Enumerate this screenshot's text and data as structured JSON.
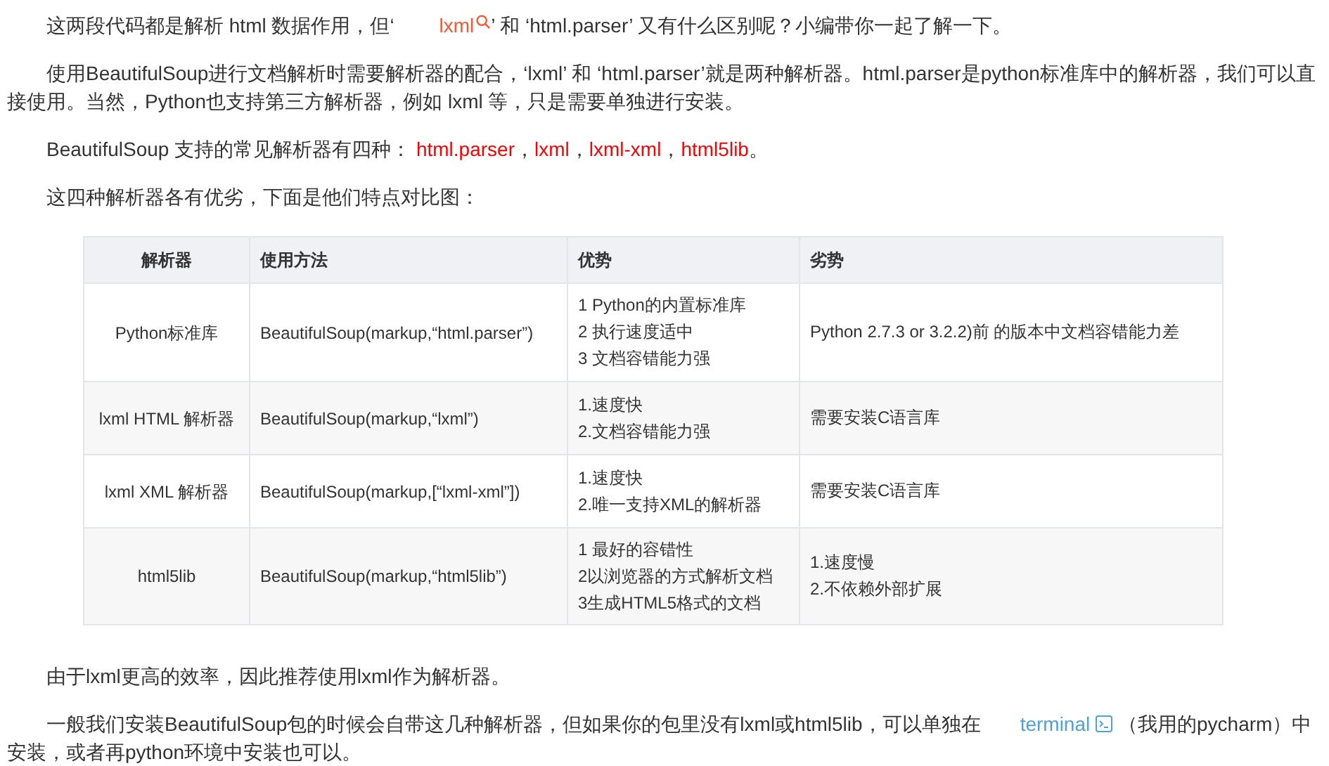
{
  "intro_paragraphs": [
    {
      "segments": [
        {
          "kind": "text",
          "text": "这两段代码都是解析 html 数据作用，但‘ "
        },
        {
          "kind": "search_link",
          "text": "lxml"
        },
        {
          "kind": "text",
          "text": "’ 和 ‘html.parser’ 又有什么区别呢？小编带你一起了解一下。"
        }
      ]
    },
    {
      "segments": [
        {
          "kind": "text",
          "text": "使用BeautifulSoup进行文档解析时需要解析器的配合，‘lxml’ 和 ‘html.parser’就是两种解析器。html.parser是python标准库中的解析器，我们可以直接使用。当然，Python也支持第三方解析器，例如 lxml 等，只是需要单独进行安装。"
        }
      ]
    },
    {
      "segments": [
        {
          "kind": "text",
          "text": "BeautifulSoup 支持的常见解析器有四种： "
        },
        {
          "kind": "highlight",
          "text": "html.parser"
        },
        {
          "kind": "text",
          "text": "，"
        },
        {
          "kind": "highlight",
          "text": "lxml"
        },
        {
          "kind": "text",
          "text": "，"
        },
        {
          "kind": "highlight",
          "text": "lxml-xml"
        },
        {
          "kind": "text",
          "text": "，"
        },
        {
          "kind": "highlight",
          "text": "html5lib"
        },
        {
          "kind": "text",
          "text": "。"
        }
      ]
    },
    {
      "segments": [
        {
          "kind": "text",
          "text": "这四种解析器各有优劣，下面是他们特点对比图："
        }
      ]
    }
  ],
  "table": {
    "columns": [
      "解析器",
      "使用方法",
      "优势",
      "劣势"
    ],
    "rows": [
      {
        "parser": "Python标准库",
        "usage": "BeautifulSoup(markup,“html.parser”)",
        "pros": [
          "1 Python的内置标准库",
          "2 执行速度适中",
          "3 文档容错能力强"
        ],
        "cons": [
          "Python 2.7.3 or 3.2.2)前 的版本中文档容错能力差"
        ]
      },
      {
        "parser": "lxml HTML 解析器",
        "usage": "BeautifulSoup(markup,“lxml”)",
        "pros": [
          "1.速度快",
          "2.文档容错能力强"
        ],
        "cons": [
          "需要安装C语言库"
        ]
      },
      {
        "parser": "lxml XML 解析器",
        "usage": "BeautifulSoup(markup,[“lxml-xml”])",
        "pros": [
          "1.速度快",
          "2.唯一支持XML的解析器"
        ],
        "cons": [
          "需要安装C语言库"
        ]
      },
      {
        "parser": "html5lib",
        "usage": "BeautifulSoup(markup,“html5lib”)",
        "pros": [
          "1 最好的容错性",
          "2以浏览器的方式解析文档",
          "3生成HTML5格式的文档"
        ],
        "cons": [
          "1.速度慢",
          "2.不依赖外部扩展"
        ]
      }
    ]
  },
  "outro_paragraphs": [
    {
      "segments": [
        {
          "kind": "text",
          "text": "由于lxml更高的效率，因此推荐使用lxml作为解析器。"
        }
      ]
    },
    {
      "segments": [
        {
          "kind": "text",
          "text": "一般我们安装BeautifulSoup包的时候会自带这几种解析器，但如果你的包里没有lxml或html5lib，可以单独在"
        },
        {
          "kind": "terminal_link",
          "text": "terminal"
        },
        {
          "kind": "text",
          "text": " （我用的pycharm）中安装，或者再python环境中安装也可以。"
        }
      ]
    }
  ]
}
